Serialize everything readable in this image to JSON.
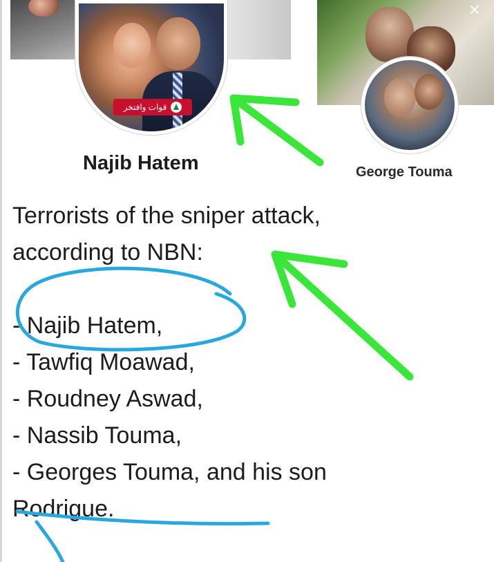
{
  "profiles": {
    "main": {
      "name": "Najib Hatem",
      "badge_text": "قوات وافتخر",
      "badge_icon": "cedar-icon"
    },
    "second": {
      "name": "George Touma"
    }
  },
  "post": {
    "lines": [
      "Terrorists of the sniper attack,",
      "according to NBN:",
      "",
      "- Najib Hatem,",
      "- Tawfiq Moawad,",
      "- Roudney Aswad,",
      "- Nassib Touma,",
      "- Georges Touma, and his son",
      "Rodrigue."
    ]
  },
  "annotations": {
    "arrow_color": "#39e639",
    "circle_color": "#29a8e0"
  }
}
